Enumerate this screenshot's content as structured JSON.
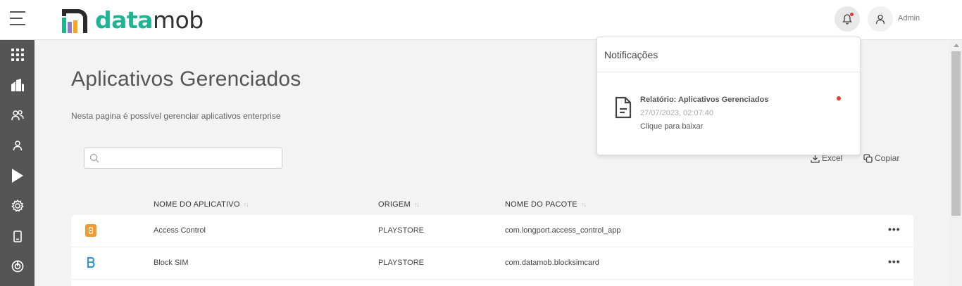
{
  "header": {
    "logo_part1": "data",
    "logo_part2": "mob",
    "user_name": "Admin"
  },
  "page": {
    "title": "Aplicativos Gerenciados",
    "subtitle": "Nesta pagina é possível gerenciar aplicativos enterprise",
    "search_placeholder": ""
  },
  "actions": {
    "excel": "Excel",
    "copy": "Copiar"
  },
  "table": {
    "columns": [
      "NOME DO APLICATIVO",
      "ORIGEM",
      "NOME DO PACOTE"
    ],
    "sort_glyph": "↑↓",
    "rows": [
      {
        "name": "Access Control",
        "origin": "PLAYSTORE",
        "package": "com.longport.access_control_app",
        "more": "•••"
      },
      {
        "name": "Block SIM",
        "origin": "PLAYSTORE",
        "package": "com.datamob.blocksimcard",
        "more": "•••"
      }
    ]
  },
  "notifications": {
    "title": "Notificações",
    "items": [
      {
        "title": "Relatório: Aplicativos Gerenciados",
        "date": "27/07/2023, 02:07:40",
        "action": "Clique para baixar"
      }
    ]
  },
  "colors": {
    "brand_green": "#1fb592",
    "sidebar": "#555555",
    "unread_dot": "#e53935"
  }
}
